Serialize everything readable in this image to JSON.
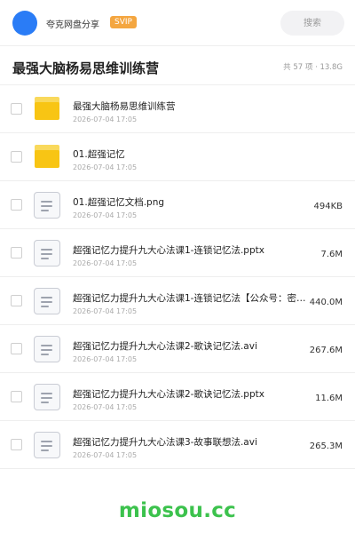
{
  "header": {
    "user_name": "夸克网盘分享",
    "vip_label": "SVIP",
    "search_placeholder": "搜索"
  },
  "folder": {
    "title": "最强大脑杨易思维训练营",
    "summary": "共 57 项 · 13.8G"
  },
  "files": [
    {
      "name": "最强大脑杨易思维训练营",
      "date": "2026-07-04 17:05",
      "size": "",
      "type": "folder"
    },
    {
      "name": "01.超强记忆",
      "date": "2026-07-04 17:05",
      "size": "",
      "type": "folder"
    },
    {
      "name": "01.超强记忆文档.png",
      "date": "2026-07-04 17:05",
      "size": "494KB",
      "type": "file"
    },
    {
      "name": "超强记忆力提升九大心法课1-连锁记忆法.pptx",
      "date": "2026-07-04 17:05",
      "size": "7.6M",
      "type": "file"
    },
    {
      "name": "超强记忆力提升九大心法课1-连锁记忆法【公众号：密…",
      "date": "2026-07-04 17:05",
      "size": "440.0M",
      "type": "file"
    },
    {
      "name": "超强记忆力提升九大心法课2-歌诀记忆法.avi",
      "date": "2026-07-04 17:05",
      "size": "267.6M",
      "type": "file"
    },
    {
      "name": "超强记忆力提升九大心法课2-歌诀记忆法.pptx",
      "date": "2026-07-04 17:05",
      "size": "11.6M",
      "type": "file"
    },
    {
      "name": "超强记忆力提升九大心法课3-故事联想法.avi",
      "date": "2026-07-04 17:05",
      "size": "265.3M",
      "type": "file"
    }
  ],
  "watermark": "miosou.cc",
  "colors": {
    "avatar": "#2a7cf6",
    "vip_badge": "#f4a640",
    "folder": "#f8c514",
    "watermark": "#3cc24d"
  },
  "icons": {
    "folder": "folder-icon",
    "file": "document-icon"
  }
}
